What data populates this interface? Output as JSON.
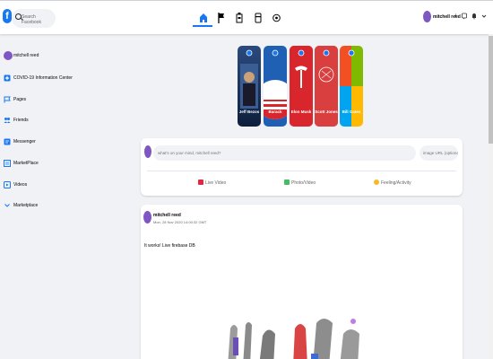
{
  "header": {
    "logo_letter": "f",
    "search_placeholder": "Search Facebook",
    "nav_icons": [
      "home-icon",
      "flag-icon",
      "store-icon",
      "group-icon",
      "gaming-icon"
    ],
    "profile_name": "mitchell reed",
    "right_icons": [
      "plus-icon",
      "messenger-icon",
      "bell-icon",
      "chevron-down-icon"
    ],
    "accent": "#1877f2"
  },
  "sidebar": {
    "items": [
      {
        "label": "mitchell reed",
        "icon": "avatar"
      },
      {
        "label": "COVID-19 Information Center",
        "icon": "covid-icon"
      },
      {
        "label": "Pages",
        "icon": "pages-flag-icon"
      },
      {
        "label": "Friends",
        "icon": "friends-icon"
      },
      {
        "label": "Messenger",
        "icon": "messenger-icon"
      },
      {
        "label": "MarketPlace",
        "icon": "marketplace-icon"
      },
      {
        "label": "Videos",
        "icon": "videos-icon"
      },
      {
        "label": "Marketplace",
        "icon": "chevron-down-icon"
      }
    ]
  },
  "stories": [
    {
      "name": "Jeff Bezos",
      "color": "#1f3a6b"
    },
    {
      "name": "Barack",
      "color": "#1f5fb4"
    },
    {
      "name": "Elon Musk",
      "color": "#d9262c"
    },
    {
      "name": "Scott Jones",
      "color": "#d93f3f"
    },
    {
      "name": "Bill Gates",
      "color": "#6aa84f"
    }
  ],
  "create_post": {
    "input_placeholder": "what's on your mind, mitchell reed?",
    "url_placeholder": "image URL (optional)",
    "buttons": [
      {
        "label": "Live Video",
        "color": "#e42645"
      },
      {
        "label": "Photo/Video",
        "color": "#45bd62"
      },
      {
        "label": "Feeling/Activity",
        "color": "#f7b928"
      }
    ]
  },
  "post": {
    "author": "mitchell reed",
    "timestamp": "Mon, 28 Nov 2020 14:00:32 GMT",
    "text": "It works! Live firebase DB"
  }
}
